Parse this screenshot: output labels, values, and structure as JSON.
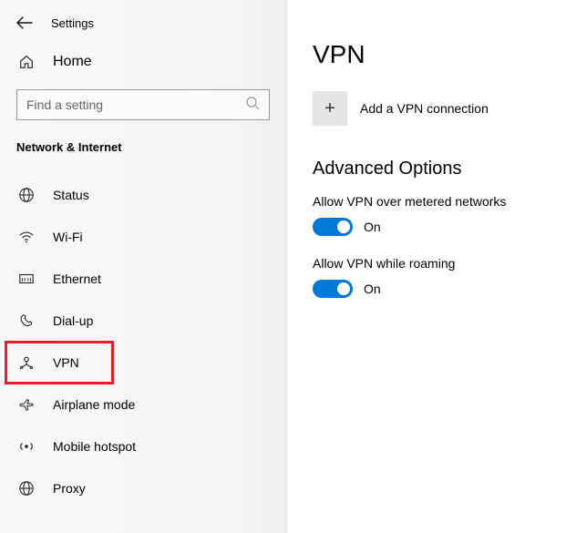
{
  "header": {
    "settings_label": "Settings"
  },
  "home_label": "Home",
  "search": {
    "placeholder": "Find a setting"
  },
  "section_label": "Network & Internet",
  "nav": {
    "status": "Status",
    "wifi": "Wi-Fi",
    "ethernet": "Ethernet",
    "dialup": "Dial-up",
    "vpn": "VPN",
    "airplane": "Airplane mode",
    "hotspot": "Mobile hotspot",
    "proxy": "Proxy"
  },
  "main": {
    "title": "VPN",
    "add_label": "Add a VPN connection",
    "add_glyph": "+",
    "adv_title": "Advanced Options",
    "opt1_label": "Allow VPN over metered networks",
    "opt1_state": "On",
    "opt2_label": "Allow VPN while roaming",
    "opt2_state": "On"
  }
}
